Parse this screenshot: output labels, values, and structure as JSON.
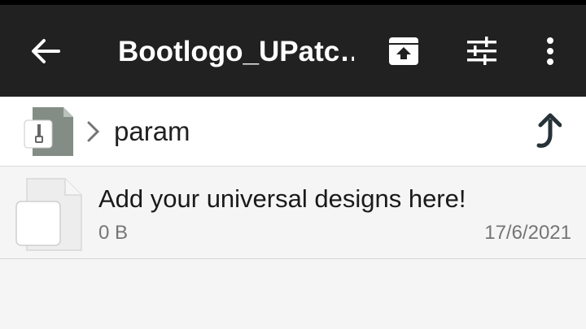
{
  "toolbar": {
    "title": "Bootlogo_UPatc…",
    "back_icon": "arrow-left-icon",
    "actions": [
      "extract-icon",
      "tune-icon",
      "more-vert-icon"
    ],
    "background": "#212121"
  },
  "pathbar": {
    "root_icon": "zip-archive-icon",
    "separator_icon": "chevron-right-icon",
    "current_folder": "param",
    "up_icon": "level-up-icon"
  },
  "files": [
    {
      "name": "Add your universal designs here!",
      "size": "0 B",
      "date": "17/6/2021",
      "icon": "file-icon"
    }
  ]
}
